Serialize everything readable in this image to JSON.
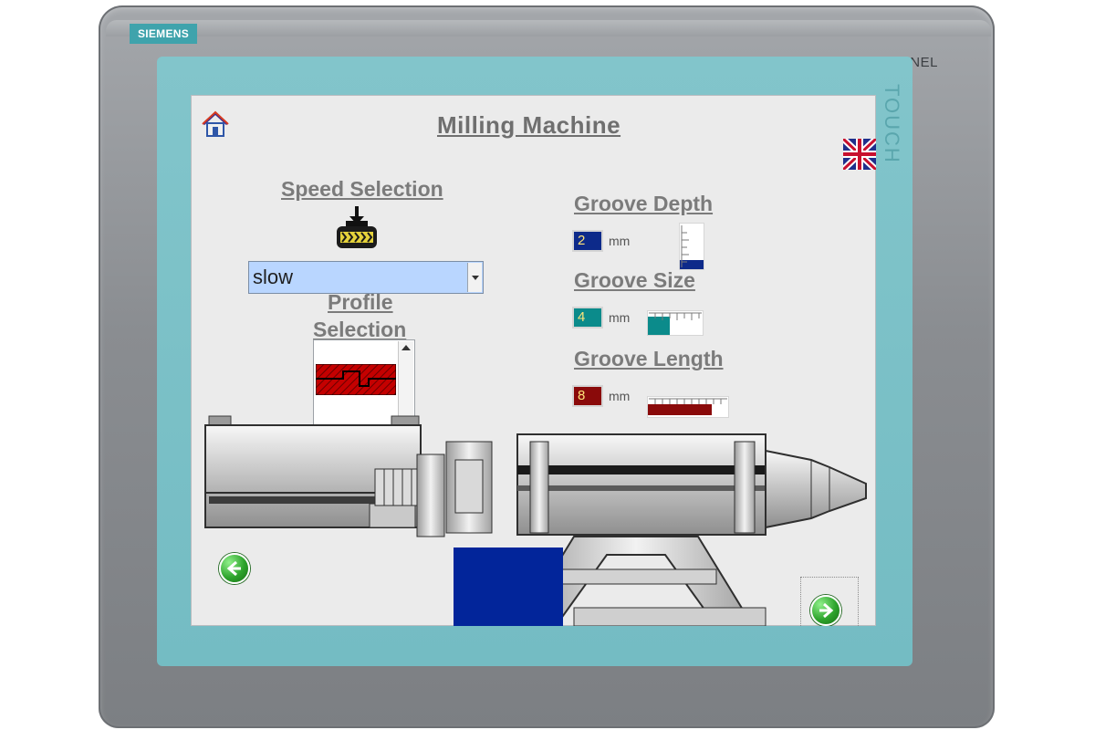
{
  "device": {
    "brand": "SIEMENS",
    "model": "SIMATIC MULTI PANEL",
    "side_label": "TOUCH"
  },
  "screen": {
    "title": "Milling Machine",
    "speed": {
      "label": "Speed Selection",
      "selected": "slow"
    },
    "profile": {
      "label_line1": "Profile",
      "label_line2": "Selection"
    },
    "groove_depth": {
      "label": "Groove Depth",
      "value": "2",
      "unit": "mm",
      "level": 0.2,
      "color": "#0d2a8a"
    },
    "groove_size": {
      "label": "Groove Size",
      "value": "4",
      "unit": "mm",
      "level": 0.4,
      "color": "#0b8b8b"
    },
    "groove_length": {
      "label": "Groove Length",
      "value": "8",
      "unit": "mm",
      "level": 0.8,
      "color": "#8a0a0a"
    }
  },
  "icons": {
    "home": "home-icon",
    "language": "uk-flag-icon",
    "back": "arrow-left-icon",
    "next": "arrow-right-icon",
    "spindle": "spindle-speed-icon"
  },
  "colors": {
    "screen_bg": "#ebebeb",
    "bezel": "#78bec4",
    "frame": "#8f9296",
    "badge": "#3fa3ac",
    "blue_block": "#02259a",
    "selection_bg": "#b9d6ff",
    "profile_red": "#c40000"
  }
}
